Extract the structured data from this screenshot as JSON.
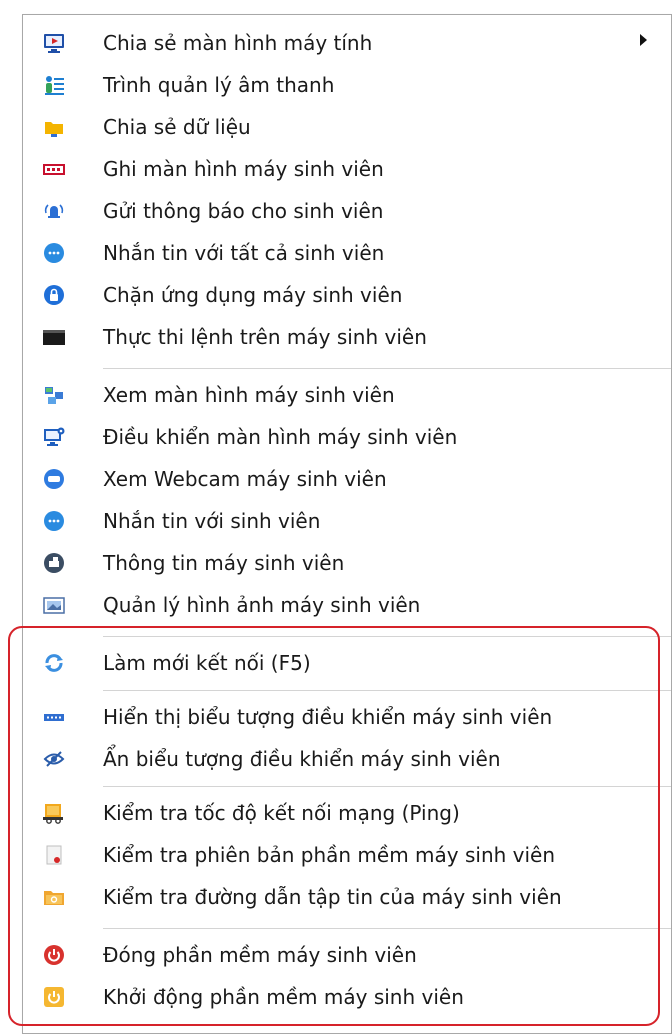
{
  "menu": {
    "items": [
      {
        "label": "Chia sẻ màn hình máy tính",
        "icon": "screen-share-icon",
        "submenu": true
      },
      {
        "label": "Trình quản lý âm thanh",
        "icon": "audio-manager-icon"
      },
      {
        "label": "Chia sẻ dữ liệu",
        "icon": "folder-share-icon"
      },
      {
        "label": "Ghi màn hình máy sinh viên",
        "icon": "record-screen-icon"
      },
      {
        "label": "Gửi thông báo cho sinh viên",
        "icon": "broadcast-bell-icon"
      },
      {
        "label": "Nhắn tin với tất cả sinh viên",
        "icon": "chat-all-icon"
      },
      {
        "label": "Chặn ứng dụng máy sinh viên",
        "icon": "block-app-icon"
      },
      {
        "label": "Thực thi lệnh trên máy sinh viên",
        "icon": "terminal-icon"
      },
      {
        "label": "Xem màn hình máy sinh viên",
        "icon": "view-screen-icon"
      },
      {
        "label": "Điều khiển màn hình máy sinh viên",
        "icon": "remote-control-icon"
      },
      {
        "label": "Xem Webcam máy sinh viên",
        "icon": "webcam-icon"
      },
      {
        "label": "Nhắn tin với sinh viên",
        "icon": "chat-icon"
      },
      {
        "label": "Thông tin máy sinh viên",
        "icon": "machine-info-icon"
      },
      {
        "label": "Quản lý hình ảnh máy sinh viên",
        "icon": "image-manager-icon"
      },
      {
        "label": "Làm mới kết nối (F5)",
        "icon": "refresh-icon"
      },
      {
        "label": "Hiển thị biểu tượng điều khiển máy sinh viên",
        "icon": "show-toolbar-icon"
      },
      {
        "label": "Ẩn biểu tượng điều khiển máy sinh viên",
        "icon": "hide-eye-icon"
      },
      {
        "label": "Kiểm tra tốc độ kết nối mạng (Ping)",
        "icon": "ping-icon"
      },
      {
        "label": "Kiểm tra phiên bản phần mềm máy sinh viên",
        "icon": "version-check-icon"
      },
      {
        "label": "Kiểm tra đường dẫn tập tin của máy sinh viên",
        "icon": "file-path-icon"
      },
      {
        "label": "Đóng phần mềm máy sinh viên",
        "icon": "power-off-icon"
      },
      {
        "label": "Khởi động phần mềm máy sinh viên",
        "icon": "startup-icon"
      }
    ]
  },
  "colors": {
    "highlight": "#d6232a",
    "text": "#1a1a1a",
    "separator": "#d4d4d4"
  }
}
